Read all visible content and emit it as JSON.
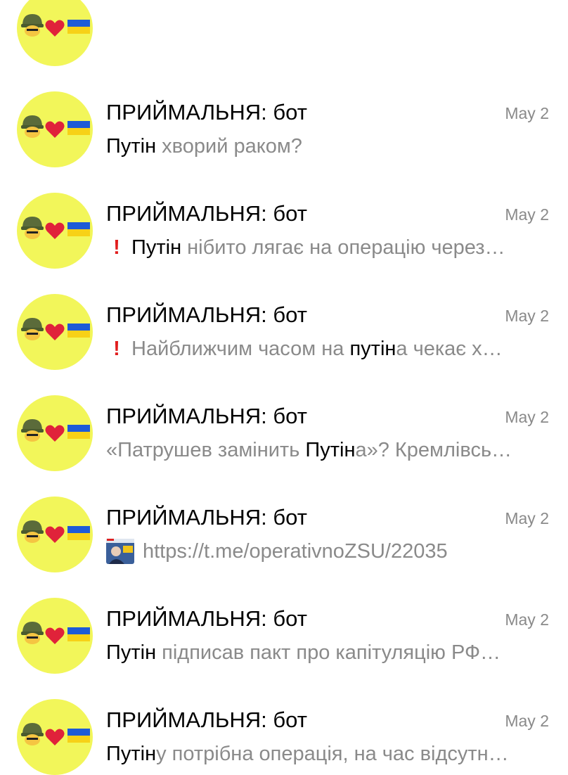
{
  "chats": [
    {
      "name": "",
      "date": "",
      "preview": [
        {
          "text": "",
          "hl": false
        }
      ],
      "clipped": true
    },
    {
      "name": "ПРИЙМАЛЬНЯ: бот",
      "date": "May 2",
      "preview": [
        {
          "text": "Путін",
          "hl": true
        },
        {
          "text": " хворий раком?",
          "hl": false
        }
      ]
    },
    {
      "name": "ПРИЙМАЛЬНЯ: бот",
      "date": "May 2",
      "prefix_icon": "exclamation-icon",
      "preview": [
        {
          "text": "Путін",
          "hl": true
        },
        {
          "text": " нібито лягає на операцію через…",
          "hl": false
        }
      ]
    },
    {
      "name": "ПРИЙМАЛЬНЯ: бот",
      "date": "May 2",
      "prefix_icon": "exclamation-icon",
      "preview": [
        {
          "text": "Найближчим часом на ",
          "hl": false
        },
        {
          "text": "путін",
          "hl": true
        },
        {
          "text": "а чекає х…",
          "hl": false
        }
      ]
    },
    {
      "name": "ПРИЙМАЛЬНЯ: бот",
      "date": "May 2",
      "preview": [
        {
          "text": "«Патрушев замінить ",
          "hl": false
        },
        {
          "text": "Путін",
          "hl": true
        },
        {
          "text": "а»? Кремлівсь…",
          "hl": false
        }
      ]
    },
    {
      "name": "ПРИЙМАЛЬНЯ: бот",
      "date": "May 2",
      "prefix_icon": "media-thumbnail",
      "preview": [
        {
          "text": "https://t.me/operativnoZSU/22035",
          "hl": false
        }
      ]
    },
    {
      "name": "ПРИЙМАЛЬНЯ: бот",
      "date": "May 2",
      "preview": [
        {
          "text": "Путін",
          "hl": true
        },
        {
          "text": " підписав пакт про капітуляцію РФ…",
          "hl": false
        }
      ]
    },
    {
      "name": "ПРИЙМАЛЬНЯ: бот",
      "date": "May 2",
      "preview": [
        {
          "text": "Путін",
          "hl": true
        },
        {
          "text": "у потрібна операція, на час відсутн…",
          "hl": false
        }
      ]
    }
  ],
  "avatar": {
    "background": "#f2f65a",
    "emoji": [
      "military-helmet-icon",
      "red-heart-icon",
      "ukraine-flag-icon"
    ]
  },
  "colors": {
    "name": "#000000",
    "preview": "#8a8a8a",
    "highlight": "#000000",
    "date": "#8a8a8a",
    "exclamation": "#e11d1d"
  }
}
